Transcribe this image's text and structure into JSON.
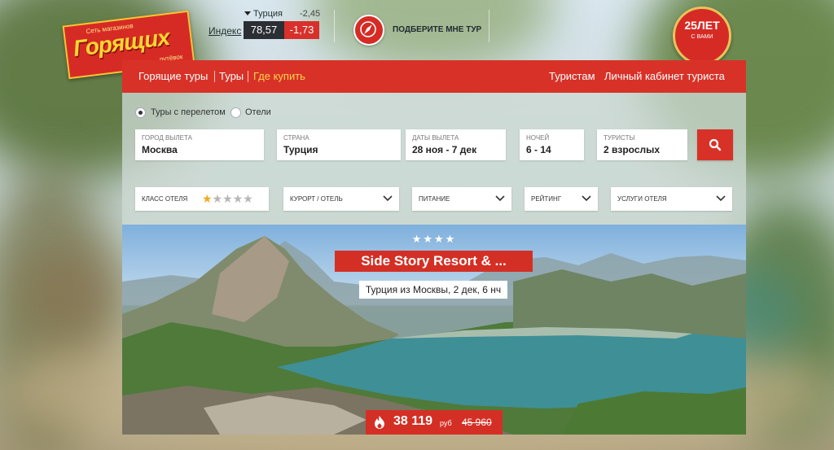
{
  "logo": {
    "top": "Сеть магазинов",
    "main": "Горящих",
    "sub": "путёвок"
  },
  "index": {
    "label": "Индекс",
    "country": "Турция",
    "change_top": "-2,45",
    "value": "78,57",
    "change": "-1,73"
  },
  "tour_picker": {
    "label": "ПОДБЕРИТЕ МНЕ ТУР"
  },
  "badge": {
    "years": "25ЛЕТ",
    "sub": "С ВАМИ"
  },
  "nav": {
    "left": [
      "Горящие туры",
      "Туры",
      "Где купить"
    ],
    "right": [
      "Туристам",
      "Личный кабинет туриста"
    ]
  },
  "search": {
    "radio": [
      {
        "label": "Туры с перелетом",
        "selected": true
      },
      {
        "label": "Отели",
        "selected": false
      }
    ],
    "fields": [
      {
        "label": "Город вылета",
        "value": "Москва"
      },
      {
        "label": "Страна",
        "value": "Турция"
      },
      {
        "label": "Даты вылета",
        "value": "28 ноя - 7 дек"
      },
      {
        "label": "Ночей",
        "value": "6 - 14"
      },
      {
        "label": "Туристы",
        "value": "2 взрослых"
      }
    ],
    "filters": [
      {
        "label": "Класс отеля",
        "stars_selected": 1,
        "stars_total": 5
      },
      {
        "label": "Курорт / отель"
      },
      {
        "label": "Питание"
      },
      {
        "label": "Рейтинг"
      },
      {
        "label": "Услуги отеля"
      }
    ]
  },
  "hero": {
    "stars": "★★★★",
    "hotel": "Side Story Resort & ...",
    "subtitle": "Турция из Москвы, 2 дек, 6 нч",
    "price": "38 119",
    "currency": "руб",
    "old_price": "45 960"
  },
  "colors": {
    "accent": "#d83228",
    "star": "#f0a91e",
    "index_dark": "#2b2e33"
  },
  "icons": [
    "compass-icon",
    "search-icon",
    "chevron-down-icon",
    "fire-icon",
    "star-icon"
  ]
}
